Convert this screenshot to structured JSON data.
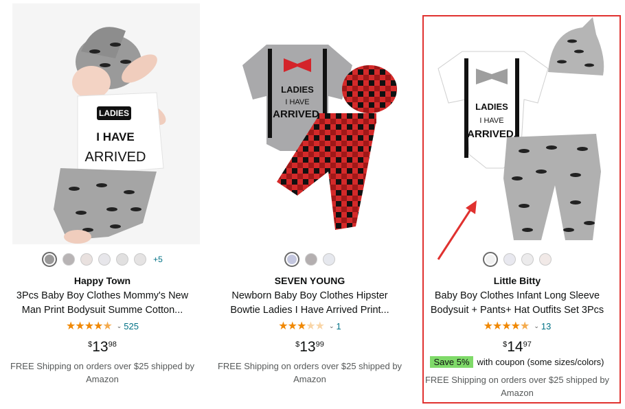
{
  "products": [
    {
      "brand": "Happy Town",
      "title_line1": "3Pcs Baby Boy Clothes Mommy's New",
      "title_line2": "Man Print Bodysuit Summe Cotton...",
      "rating": 4.5,
      "review_count": "525",
      "price_whole": "13",
      "price_fraction": "98",
      "currency": "$",
      "shipping": "FREE Shipping on orders over $25 shipped by Amazon",
      "more_colors": "+5",
      "swatches": [
        "#9a9999",
        "#b8b4b5",
        "#e9e1df",
        "#e7e6ea",
        "#e1e0e0",
        "#e5e3e3"
      ],
      "image_label": "LADIES I HAVE ARRIVED"
    },
    {
      "brand": "SEVEN YOUNG",
      "title_line1": "Newborn Baby Boy Clothes Hipster",
      "title_line2": "Bowtie Ladies I Have Arrived Print...",
      "rating": 3.5,
      "review_count": "1",
      "price_whole": "13",
      "price_fraction": "99",
      "currency": "$",
      "shipping": "FREE Shipping on orders over $25 shipped by Amazon",
      "swatches": [
        "#c4c7df",
        "#b4afb0",
        "#e6e8ee"
      ],
      "image_label": "LADIES I HAVE ARRIVED."
    },
    {
      "brand": "Little Bitty",
      "title_line1": "Baby Boy Clothes Infant Long Sleeve",
      "title_line2": "Bodysuit + Pants+ Hat Outfits Set 3Pcs",
      "rating": 4.5,
      "review_count": "13",
      "price_whole": "14",
      "price_fraction": "97",
      "currency": "$",
      "coupon_badge": "Save 5%",
      "coupon_text": "with coupon (some sizes/colors)",
      "shipping": "FREE Shipping on orders over $25 shipped by Amazon",
      "swatches": [
        "#f1f1f1",
        "#e8e8ef",
        "#ecebec",
        "#f1e9e7"
      ],
      "image_label": "LADIES I HAVE ARRIVED."
    }
  ],
  "colors": {
    "highlight": "#e0312f",
    "star": "#f08804",
    "link": "#007185",
    "coupon": "#7fda69"
  }
}
